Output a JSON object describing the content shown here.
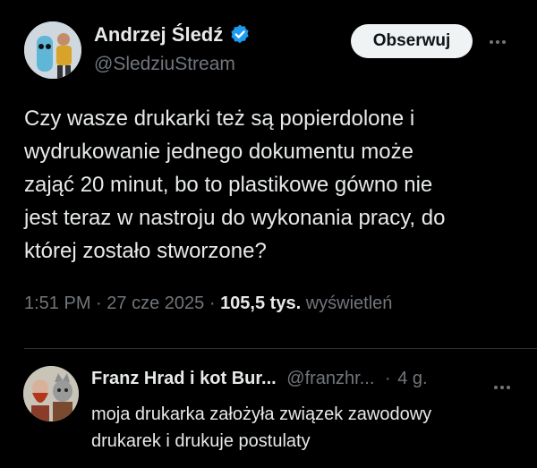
{
  "tweet": {
    "author_name": "Andrzej Śledź",
    "handle": "@SledziuStream",
    "follow_label": "Obserwuj",
    "text": "Czy wasze drukarki też są popierdolone i\nwydrukowanie jednego dokumentu może\nzająć 20 minut, bo to plastikowe gówno nie\njest teraz w nastroju do wykonania pracy, do\nktórej zostało stworzone?",
    "time": "1:51 PM",
    "date": "27 cze 2025",
    "views_count": "105,5 tys.",
    "views_label": "wyświetleń",
    "separator": "·"
  },
  "reply": {
    "author_name": "Franz Hrad i kot Bur...",
    "handle": "@franzhr...",
    "age": "4 g.",
    "separator": "·",
    "text": "moja drukarka założyła związek zawodowy\ndrukarek i drukuje postulaty"
  },
  "colors": {
    "background": "#000000",
    "text": "#e7e9ea",
    "secondary": "#71767b",
    "verified": "#1d9bf0",
    "follow_bg": "#eff3f4"
  },
  "icons": [
    "verified-badge-icon",
    "more-options-icon"
  ]
}
